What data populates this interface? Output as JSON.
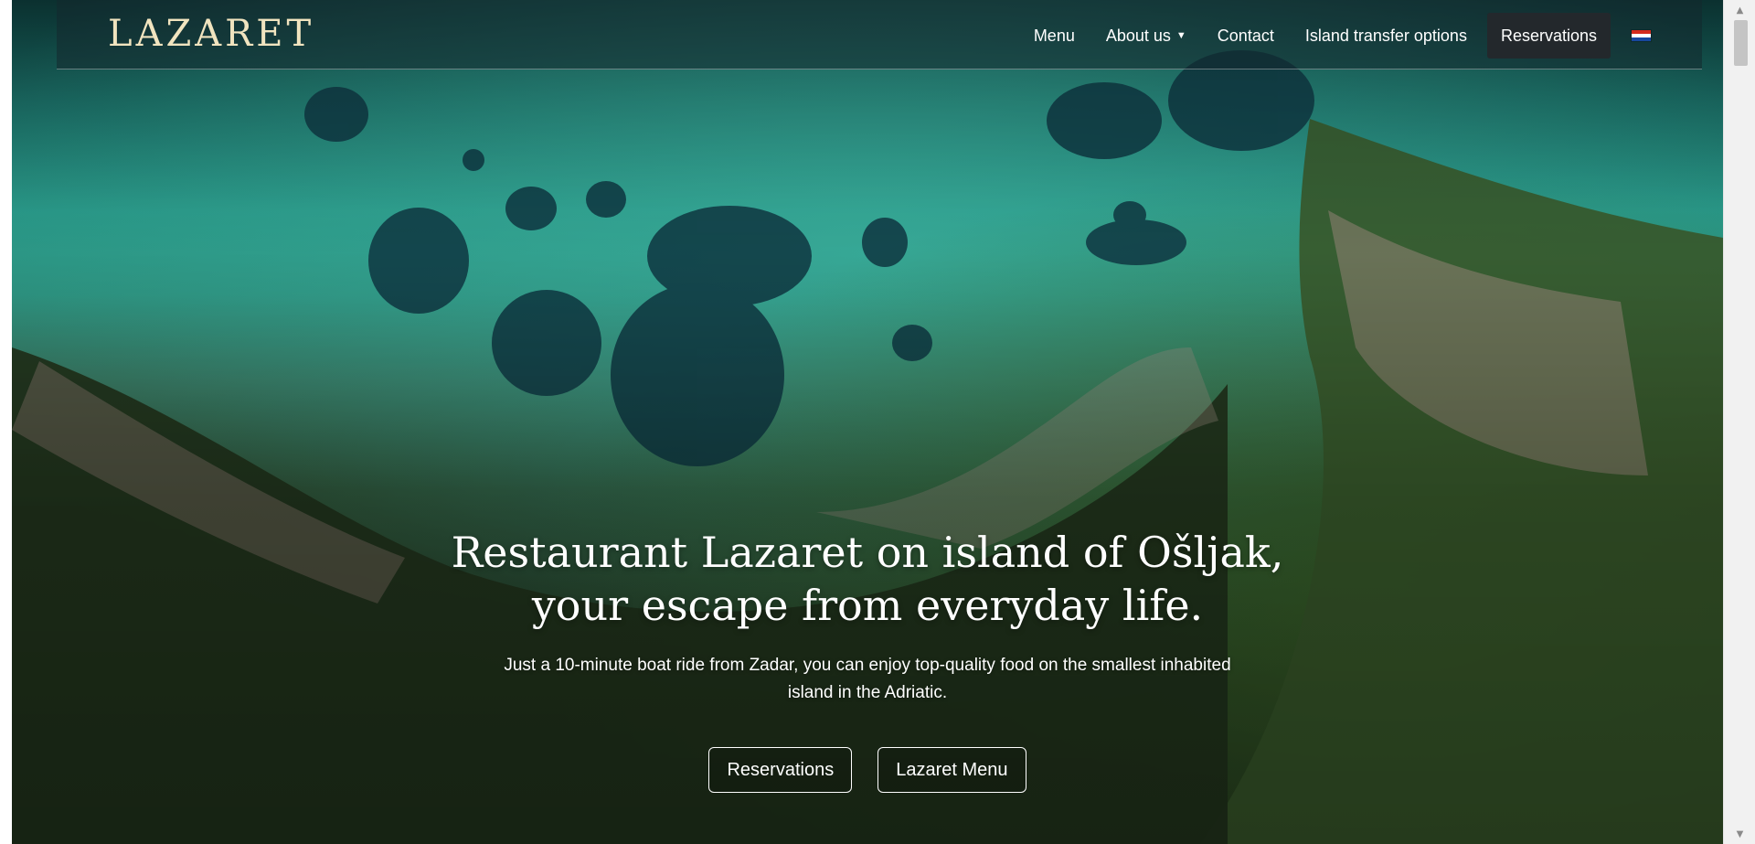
{
  "brand": {
    "logo": "LAZARET"
  },
  "nav": {
    "items": [
      {
        "label": "Menu"
      },
      {
        "label": "About us",
        "has_dropdown": true
      },
      {
        "label": "Contact"
      },
      {
        "label": "Island transfer options"
      }
    ],
    "reservations_label": "Reservations",
    "language_flag": "croatia-flag-icon",
    "dropdown_icon": "caret-down-icon"
  },
  "hero": {
    "headline": "Restaurant Lazaret on island of Ošljak, your escape from everyday life.",
    "subtext": "Just a 10-minute boat ride from Zadar, you can enjoy top-quality food on the smallest inhabited island in the Adriatic.",
    "buttons": [
      {
        "label": "Reservations"
      },
      {
        "label": "Lazaret Menu"
      }
    ]
  },
  "colors": {
    "logo": "#f1e4bf",
    "nav_reservations_bg": "#23282c",
    "text": "#ffffff"
  },
  "scrollbar": {
    "up_icon": "scroll-up-arrow-icon",
    "down_icon": "scroll-down-arrow-icon"
  }
}
